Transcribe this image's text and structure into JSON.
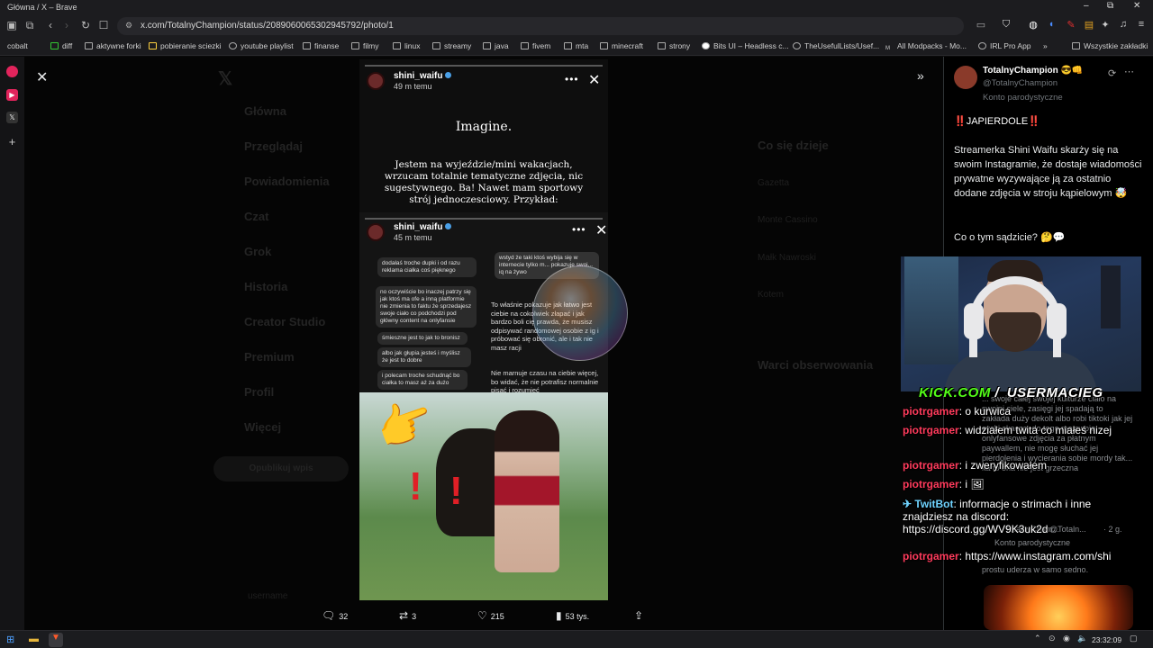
{
  "browser": {
    "window_title": "Główna / X – Brave",
    "url": "x.com/TotalnyChampion/status/2089060065302945792/photo/1",
    "window_controls": {
      "minimize": "–",
      "restore": "⧉",
      "close": "✕"
    }
  },
  "bookmarks": [
    {
      "label": "cobalt"
    },
    {
      "label": "diff"
    },
    {
      "label": "aktywne forki"
    },
    {
      "label": "pobieranie sciezki"
    },
    {
      "label": "youtube playlist"
    },
    {
      "label": "finanse"
    },
    {
      "label": "filmy"
    },
    {
      "label": "linux"
    },
    {
      "label": "streamy"
    },
    {
      "label": "java"
    },
    {
      "label": "fivem"
    },
    {
      "label": "mta"
    },
    {
      "label": "minecraft"
    },
    {
      "label": "strony"
    },
    {
      "label": "Bits UI – Headless c..."
    },
    {
      "label": "TheUsefulLists/Usef..."
    },
    {
      "label": "All Modpacks - Mo..."
    },
    {
      "label": "IRL Pro App"
    },
    {
      "label": "»"
    },
    {
      "label": "Wszystkie zakładki"
    }
  ],
  "x_background_nav": [
    "Główna",
    "Przeglądaj",
    "Powiadomienia",
    "Czat",
    "Grok",
    "Historia",
    "Creator Studio",
    "Premium",
    "Profil",
    "Więcej"
  ],
  "x_background_post_button": "Opublikuj wpis",
  "x_background_trends_title": "Co się dzieje",
  "x_background_trends": [
    "Gazetta",
    "Monte Cassino",
    "Małk Nawroski",
    "Kotem"
  ],
  "x_background_follow_title": "Warci obserwowania",
  "x_background_username": "username",
  "photo": {
    "story1": {
      "username": "shini_waifu",
      "time": "49 m temu",
      "heading": "Imagine.",
      "paragraph": "Jestem na wyjeździe/mini wakacjach, wrzucam totalnie tematyczne zdjęcia, nic sugestywnego. Ba! Nawet mam sportowy strój jednoczesciowy. Przykład:"
    },
    "story2": {
      "username": "shini_waifu",
      "time": "45 m temu",
      "chat_left": [
        "dodałaś troche dupki i od razu reklama ciałka coś pięknego",
        "no oczywiście bo inaczej patrzy się jak ktoś ma ofe a inną platformie nie zmienia to faktu że sprzedajesz swoje ciało co podchodzi pod główny content na onlyfansie",
        "śmieszne jest to jak to bronisz",
        "albo jak głupia jesteś i myślisz że jest to dobre",
        "i polecam troche schudnąć bo ciałka to masz aż za dużo"
      ],
      "chat_right": [
        "wstyd że taki ktoś wybija się w internecie tylko m... pokazuje swoi... iq na żywo",
        "To właśnie pokazuje jak łatwo jest ciebie na cokolwiek złapać i jak bardzo boli cię prawda, że musisz odpisywać randomowej osobie z ig i próbować się obronić, ale i tak nie masz racji",
        "Nie marnuje czasu na ciebie więcej, bo widać, że nie potrafisz normalnie pisać i rozumieć"
      ]
    }
  },
  "actions": {
    "replies": "32",
    "reposts": "3",
    "likes": "215",
    "views": "53 tys."
  },
  "tweet": {
    "name": "TotalnyChampion 😎👊",
    "handle": "@TotalnyChampion",
    "label": "Konto parodystyczne",
    "p1": "‼️JAPIERDOLE‼️",
    "p2": "Streamerka Shini Waifu skarży się na swoim Instagramie, że dostaje wiadomości prywatne wyzywające ją za ostatnio dodane zdjęcia w stroju kąpielowym 🤯",
    "p3": "Co o tym sądzicie? 🤔💬"
  },
  "stream_overlay": {
    "kick": "KICK.COM",
    "separator": "/",
    "channel": "USERMACIEG",
    "chat": [
      {
        "user": "piotrgamer",
        "text": ": o kurwica"
      },
      {
        "user": "piotrgamer",
        "text": ": widziałem twita co miałeś nizej"
      },
      {
        "user": "piotrgamer",
        "text": ": i zweryfikowałem"
      },
      {
        "user": "piotrgamer",
        "text": ": i 🖼"
      },
      {
        "user": "TwitBot",
        "text": ": informacje o strimach i inne znajdziesz na discord: https://discord.gg/WV9K3uk2d"
      },
      {
        "user": "piotrgamer",
        "text": ": https://www.instagram.com/shi"
      }
    ]
  },
  "bg_tweet_reply": {
    "text1": "... swoje całej swojej kulturze ciało na swojej ciele, zasięgi jej spadają to zakłada duży dekolt albo robi tiktoki jak jej cycki skaczą, do tego ma swoje onlyfansowe zdjęcia za płatnym paywallem, nie mogę słuchać jej pierdolenia i wycierania sobie mordy tak... ka to ona nie jest grzeczna",
    "name": "TotalnyCham...",
    "handle": "@Totaln...",
    "time": "· 2 g.",
    "label": "Konto parodystyczne",
    "text2": "prostu uderza w samo sedno."
  },
  "taskbar": {
    "time": "23:32:09"
  }
}
